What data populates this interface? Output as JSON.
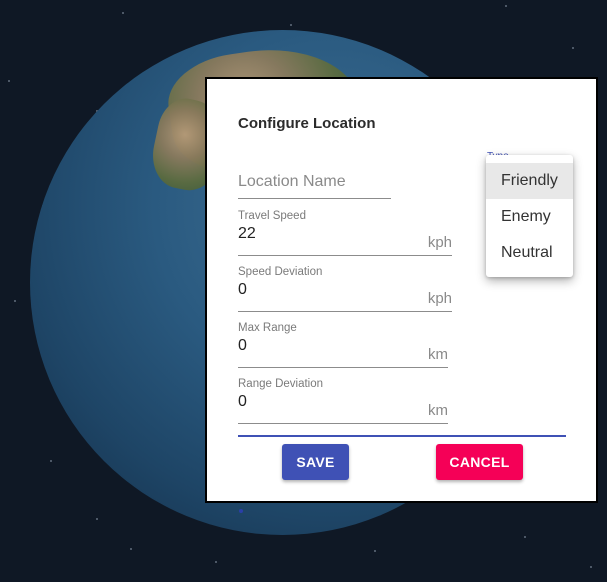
{
  "dialog": {
    "title": "Configure Location",
    "location_name": {
      "placeholder": "Location Name",
      "value": ""
    },
    "fields": [
      {
        "label": "Travel Speed",
        "value": "22",
        "unit": "kph"
      },
      {
        "label": "Speed Deviation",
        "value": "0",
        "unit": "kph"
      },
      {
        "label": "Max Range",
        "value": "0",
        "unit": "km"
      },
      {
        "label": "Range Deviation",
        "value": "0",
        "unit": "km"
      }
    ],
    "type": {
      "label": "Type",
      "selected": "Friendly",
      "options": [
        "Friendly",
        "Enemy",
        "Neutral"
      ]
    },
    "buttons": {
      "save": "SAVE",
      "cancel": "CANCEL"
    }
  },
  "colors": {
    "primary": "#3f51b5",
    "secondary": "#f50057",
    "background": "#0f1825"
  }
}
